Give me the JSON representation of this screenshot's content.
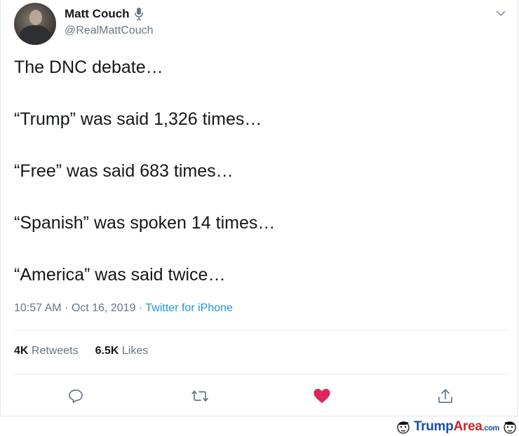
{
  "author": {
    "display_name": "Matt Couch",
    "handle": "@RealMattCouch"
  },
  "tweet": {
    "lines": [
      "The DNC debate…",
      "“Trump” was said 1,326 times…",
      "“Free” was said 683 times…",
      "“Spanish” was spoken 14 times…",
      "“America” was said twice…"
    ],
    "time": "10:57 AM",
    "date": "Oct 16, 2019",
    "separator": "·",
    "source": "Twitter for iPhone"
  },
  "stats": {
    "retweets_count": "4K",
    "retweets_label": "Retweets",
    "likes_count": "6.5K",
    "likes_label": "Likes"
  },
  "watermark": {
    "trump": "Trump",
    "area": "Area",
    "com": ".com"
  },
  "colors": {
    "like_active": "#e0245e",
    "link": "#1b95e0",
    "muted": "#657786"
  },
  "icons": {
    "reply": "reply-icon",
    "retweet": "retweet-icon",
    "like": "heart-icon",
    "share": "share-icon",
    "menu": "chevron-down-icon",
    "voice": "microphone-icon"
  }
}
